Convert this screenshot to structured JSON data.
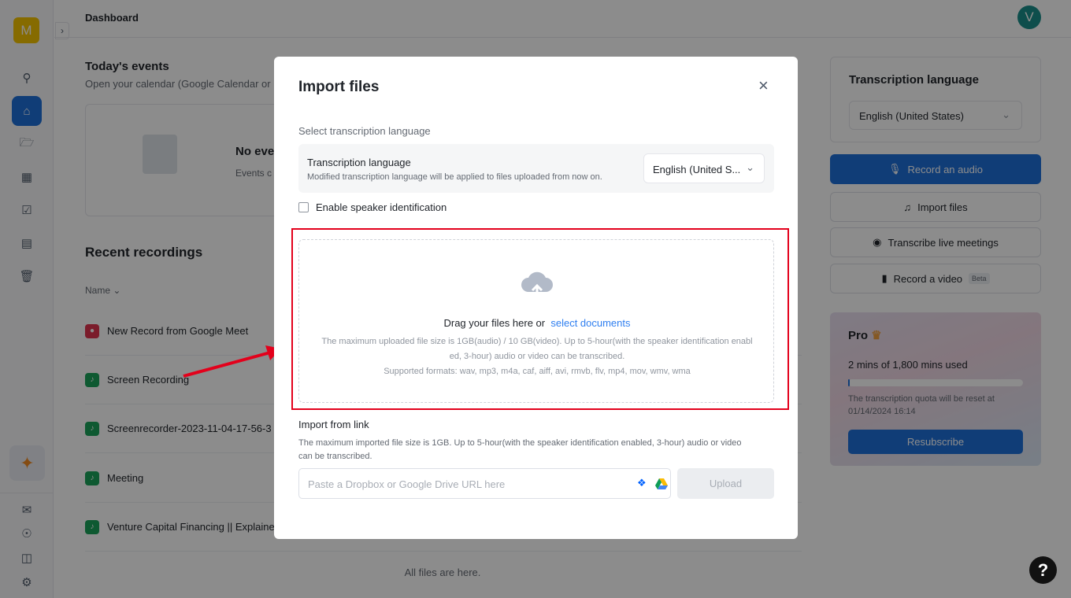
{
  "sidebar": {
    "logo_letter": "M",
    "icons": [
      "search-icon",
      "home-icon",
      "folder-icon",
      "calendar-icon",
      "calendar-check-icon",
      "document-icon",
      "trash-icon"
    ],
    "bottom_icons": [
      "feedback-icon",
      "lightbulb-icon",
      "gift-icon",
      "settings-icon"
    ]
  },
  "header": {
    "title": "Dashboard",
    "avatar_letter": "V"
  },
  "events": {
    "title": "Today's events",
    "subtitle": "Open your calendar (Google Calendar or",
    "empty_title": "No eve",
    "empty_text": "Events c"
  },
  "recordings": {
    "title": "Recent recordings",
    "name_column": "Name",
    "rows": [
      {
        "name": "New Record from Google Meet",
        "type": "meet"
      },
      {
        "name": "Screen Recording",
        "type": "file"
      },
      {
        "name": "Screenrecorder-2023-11-04-17-56-3",
        "type": "file"
      },
      {
        "name": "Meeting",
        "type": "file"
      },
      {
        "name": "Venture Capital Financing || Explaine",
        "type": "file"
      }
    ],
    "footer": "All files are here."
  },
  "right_panel": {
    "language_title": "Transcription language",
    "language_value": "English (United States)",
    "record_audio": "Record an audio",
    "import_files": "Import files",
    "live_meetings": "Transcribe live meetings",
    "record_video": "Record a video",
    "beta": "Beta",
    "plan": {
      "name": "Pro",
      "usage": "2 mins of 1,800 mins used",
      "usage_fraction": 0.0011,
      "reset_text": "The transcription quota will be reset at",
      "reset_date": "01/14/2024 16:14",
      "resubscribe": "Resubscribe"
    }
  },
  "modal": {
    "title": "Import files",
    "section_label": "Select transcription language",
    "lang_title": "Transcription language",
    "lang_desc": "Modified transcription language will be applied to files uploaded from now on.",
    "lang_value": "English (United S...",
    "speaker_label": "Enable speaker identification",
    "speaker_checked": false,
    "drop": {
      "text": "Drag your files here or",
      "link": "select documents",
      "limit": "The maximum uploaded file size is 1GB(audio) / 10 GB(video). Up to 5-hour(with the speaker identification enabl",
      "limit2": "ed, 3-hour) audio or video can be transcribed.",
      "formats": "Supported formats: wav, mp3, m4a, caf, aiff, avi, rmvb, flv, mp4, mov, wmv, wma"
    },
    "link": {
      "title": "Import from link",
      "desc": "The maximum imported file size is 1GB. Up to 5-hour(with the speaker identification enabled, 3-hour) audio or video",
      "desc2": "can be transcribed.",
      "placeholder": "Paste a Dropbox or Google Drive URL here",
      "upload": "Upload"
    }
  },
  "colors": {
    "accent": "#1e6fd9",
    "highlight": "#e3001b",
    "link": "#2f7ff0"
  }
}
